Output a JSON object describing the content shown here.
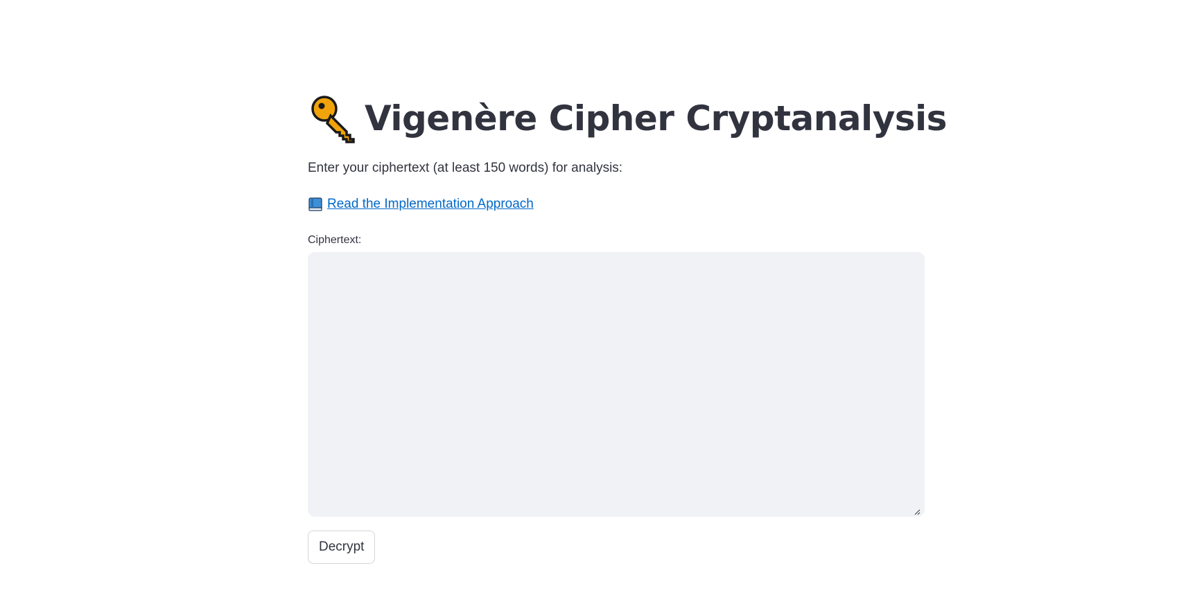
{
  "page": {
    "title": "Vigenère Cipher Cryptanalysis",
    "title_icon": "key-icon",
    "subtitle": "Enter your ciphertext (at least 150 words) for analysis:",
    "link": {
      "icon": "book-icon",
      "label": " Read the Implementation Approach"
    }
  },
  "form": {
    "ciphertext_label": "Ciphertext:",
    "ciphertext_value": "",
    "ciphertext_placeholder": "",
    "decrypt_label": "Decrypt"
  },
  "colors": {
    "text": "#31333f",
    "link": "#0068c9",
    "textarea_bg": "#f0f2f6",
    "key": "#f0a30a"
  }
}
